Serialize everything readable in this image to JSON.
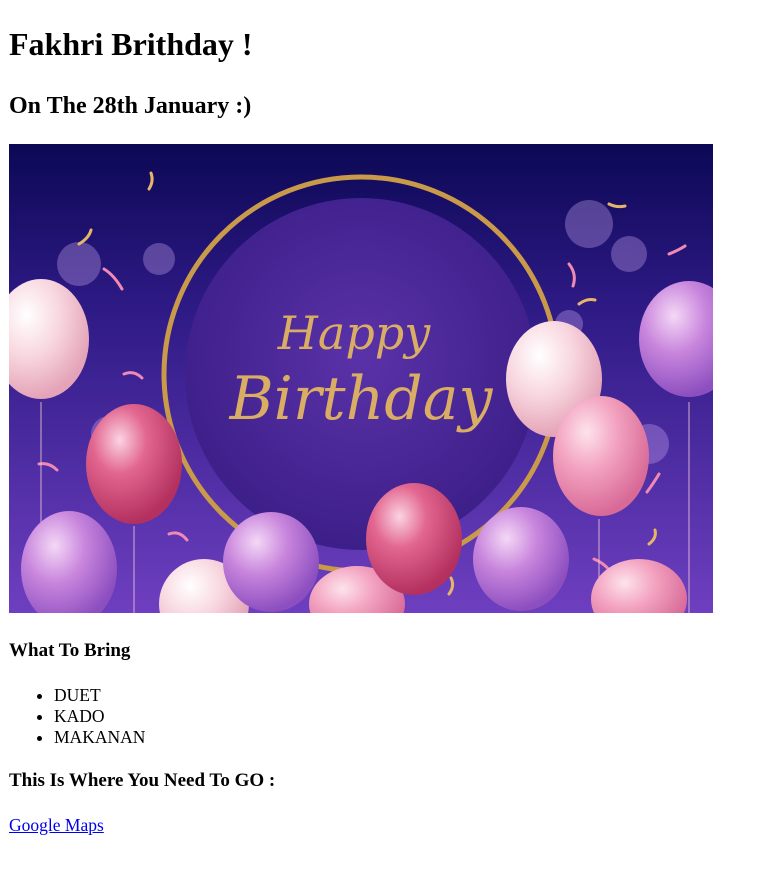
{
  "page": {
    "title": "Fakhri Brithday !",
    "subtitle": "On The 28th January :)"
  },
  "banner": {
    "text_line1": "Happy",
    "text_line2": "Birthday",
    "colors": {
      "bg_top": "#12094f",
      "bg_mid": "#3b1d8a",
      "bg_bottom": "#6a3ab8",
      "ring": "#c99a4a",
      "text": "#d9ad63",
      "balloon_pink": "#e0568a",
      "balloon_light": "#f7c9d6",
      "balloon_violet": "#b57ad8"
    }
  },
  "bring": {
    "heading": "What To Bring",
    "items": [
      "DUET",
      "KADO",
      "MAKANAN"
    ]
  },
  "location": {
    "heading": "This Is Where You Need To GO :",
    "link_label": "Google Maps",
    "link_color": "#0000ee"
  }
}
